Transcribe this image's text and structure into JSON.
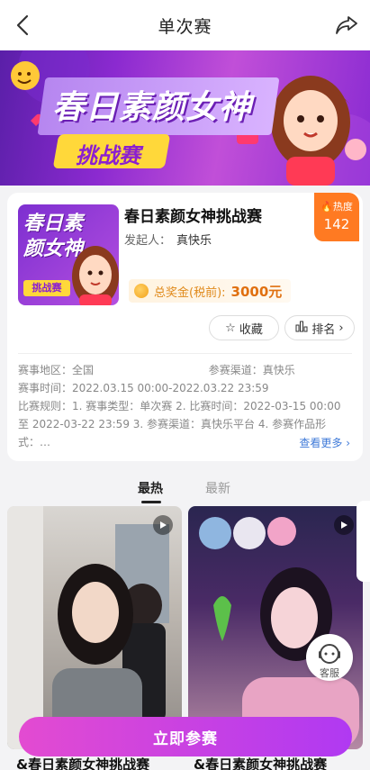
{
  "header": {
    "title": "单次赛",
    "back_icon": "chevron-left-icon",
    "share_icon": "share-icon"
  },
  "banner": {
    "title_main": "春日素颜女神",
    "title_sub": "挑战赛"
  },
  "competition": {
    "thumb_text": "春日素颜女神",
    "thumb_tag": "挑战赛",
    "title": "春日素颜女神挑战赛",
    "organizer_label": "发起人：",
    "organizer": "真快乐",
    "prize_label": "总奖金(税前):",
    "prize_amount": "3000元",
    "heat_label": "热度",
    "heat_value": "142",
    "favorite_label": "收藏",
    "ranking_label": "排名",
    "region_label": "赛事地区：",
    "region": "全国",
    "channel_label": "参赛渠道：",
    "channel": "真快乐",
    "time_label": "赛事时间：",
    "time": "2022.03.15 00:00-2022.03.22 23:59",
    "rules": "比赛规则：1. 赛事类型：单次赛 2. 比赛时间：2022-03-15 00:00 至 2022-03-22 23:59 3. 参赛渠道：真快乐平台 4. 参赛作品形式：…",
    "more_label": "查看更多 ›"
  },
  "tabs": [
    {
      "label": "最热",
      "active": true
    },
    {
      "label": "最新",
      "active": false
    }
  ],
  "videos": [
    {
      "title": "&春日素颜女神挑战赛"
    },
    {
      "title": "&春日素颜女神挑战赛"
    }
  ],
  "service_label": "客服",
  "cta_label": "立即参赛"
}
